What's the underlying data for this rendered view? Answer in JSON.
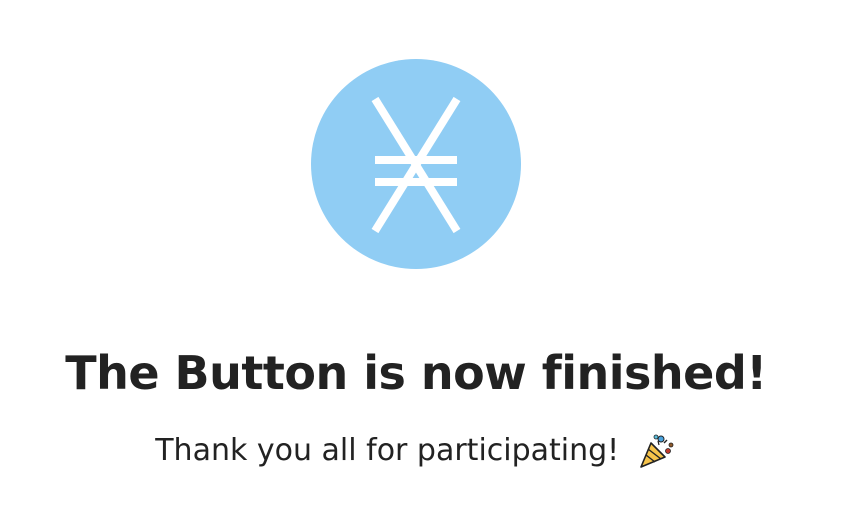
{
  "logo": {
    "icon": "xrp-x-symbol",
    "circle_color": "#90cdf4",
    "mark_color": "#ffffff"
  },
  "title": "The Button is now finished!",
  "subtitle": "Thank you all for participating!",
  "subtitle_icon": "party-popper-icon",
  "colors": {
    "text": "#222222",
    "background": "#ffffff"
  }
}
